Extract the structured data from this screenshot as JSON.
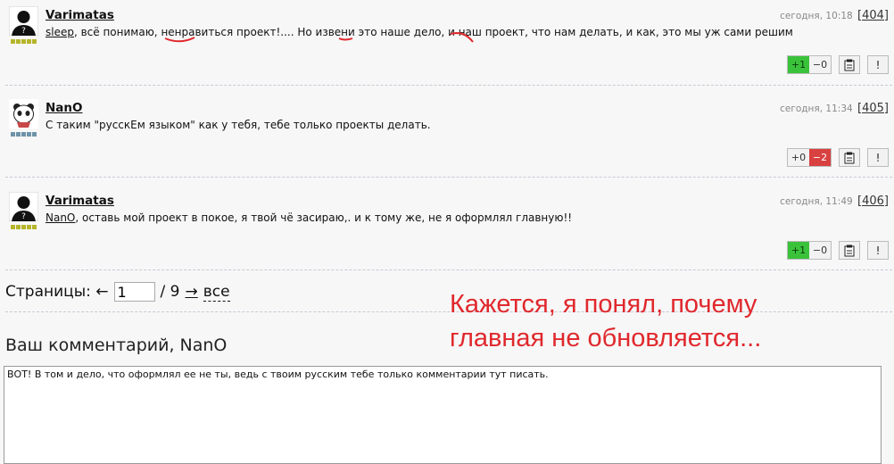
{
  "comments": [
    {
      "author": "Varimatas",
      "time": "сегодня, 10:18",
      "number": "[404]",
      "ref": "sleep",
      "text_parts": [
        ", всё понимаю, ",
        "ненравиться",
        " проект!.... Но ",
        "извени",
        " это наше ",
        "дело",
        ", и наш проект, что нам делать, и как, это мы уж сами решим"
      ],
      "vote_up": "+1",
      "vote_down": "−0",
      "report": "!"
    },
    {
      "author": "NanO",
      "time": "сегодня, 11:34",
      "number": "[405]",
      "text": "С таким \"русскЕм языком\" как у тебя, тебе только проекты делать.",
      "vote_up": "+0",
      "vote_down": "−2",
      "report": "!"
    },
    {
      "author": "Varimatas",
      "time": "сегодня, 11:49",
      "number": "[406]",
      "ref": "NanO",
      "text": ", оставь мой проект в покое, я твой чё засираю,. и к тому же, не я оформлял главную!!",
      "vote_up": "+1",
      "vote_down": "−0",
      "report": "!"
    }
  ],
  "pager": {
    "label": "Страницы: ←",
    "current": "1",
    "total": "/ 9",
    "next": "→",
    "all": "все"
  },
  "annotation": {
    "line1": "Кажется, я понял, почему",
    "line2": "главная не обновляется..."
  },
  "form": {
    "title": "Ваш комментарий, NanO",
    "value": "ВОТ! В том и дело, что оформлял ее не ты, ведь с твоим русским тебе только комментарии тут писать."
  },
  "colors": {
    "vote_up_active": "#3bc23b",
    "vote_down_active": "#d94040",
    "annotation": "#e0282d",
    "rating_green": "#b5b52a",
    "rating_blue": "#6f93a8"
  }
}
